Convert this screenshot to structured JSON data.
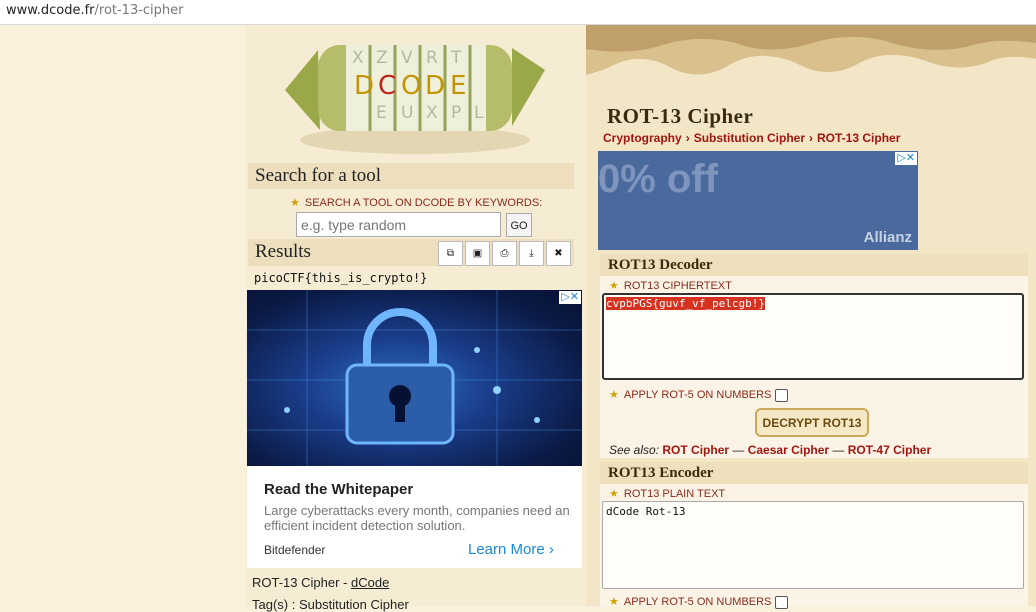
{
  "browser": {
    "url_host": "www.dcode.fr",
    "url_path": "/rot-13-cipher"
  },
  "logo": {
    "text": "DCODE",
    "cylinder_letters": [
      "X",
      "Z",
      "V",
      "R",
      "T",
      "E",
      "U",
      "X",
      "P",
      "L"
    ]
  },
  "search": {
    "title": "Search for a tool",
    "label": "SEARCH A TOOL ON DCODE BY KEYWORDS:",
    "placeholder": "e.g. type random",
    "go": "GO"
  },
  "results": {
    "title": "Results",
    "output": "picoCTF{this_is_crypto!}",
    "tools": [
      "copy-icon",
      "save-icon",
      "print-icon",
      "download-icon",
      "close-icon"
    ]
  },
  "ad_left": {
    "title": "Read the Whitepaper",
    "description": "Large cyberattacks every month, companies need an efficient incident detection solution.",
    "brand": "Bitdefender",
    "cta": "Learn More",
    "cta_arrow": "›"
  },
  "footer": {
    "tool": "ROT-13 Cipher - ",
    "site": "dCode",
    "tags": "Tag(s) : Substitution Cipher"
  },
  "page": {
    "title": "ROT-13 Cipher"
  },
  "breadcrumb": [
    "Cryptography",
    "Substitution Cipher",
    "ROT-13 Cipher"
  ],
  "ad_right": {
    "big_text": "0% off",
    "brand": "Allianz"
  },
  "decoder": {
    "title": "ROT13 Decoder",
    "label": "ROT13 CIPHERTEXT",
    "value": "cvpbPGS{guvf_vf_pelcgb!}",
    "rot5_label": "APPLY ROT-5 ON NUMBERS",
    "button": "DECRYPT ROT13",
    "see_also_prefix": "See also: ",
    "see_also": [
      "ROT Cipher",
      "Caesar Cipher",
      "ROT-47 Cipher"
    ],
    "sep": " — "
  },
  "encoder": {
    "title": "ROT13 Encoder",
    "label": "ROT13 PLAIN TEXT",
    "value": "dCode Rot-13",
    "rot5_label": "APPLY ROT-5 ON NUMBERS"
  },
  "colors": {
    "accent": "#a3150f",
    "ad_blue": "#4a6a9e",
    "link": "#1a88d8"
  }
}
